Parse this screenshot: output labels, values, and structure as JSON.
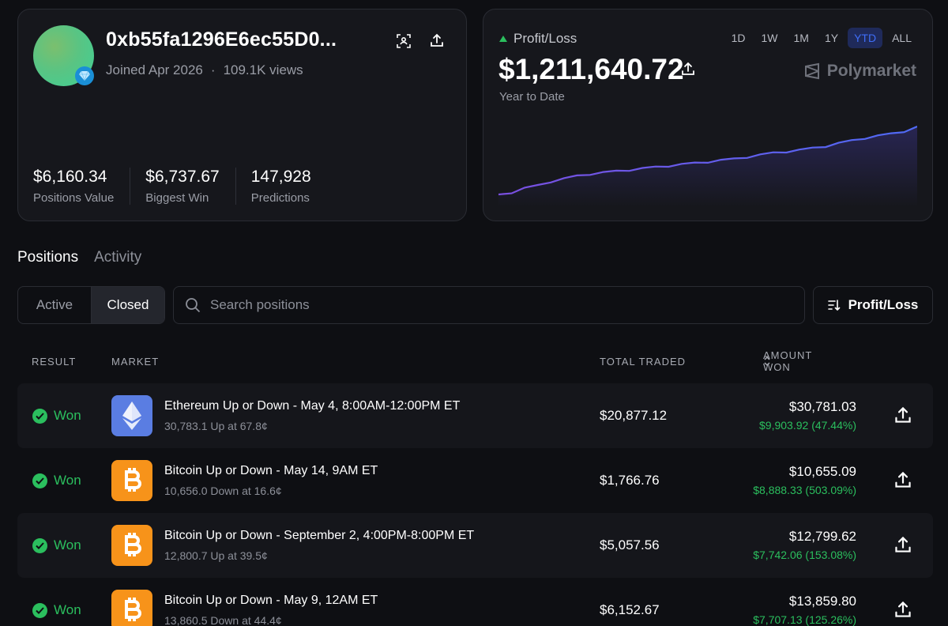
{
  "profile": {
    "username": "0xb55fa1296E6ec55D0...",
    "joined": "Joined Apr 2026",
    "separator": "·",
    "views": "109.1K views",
    "stats": [
      {
        "value": "$6,160.34",
        "label": "Positions Value"
      },
      {
        "value": "$6,737.67",
        "label": "Biggest Win"
      },
      {
        "value": "147,928",
        "label": "Predictions"
      }
    ]
  },
  "pnl": {
    "title": "Profit/Loss",
    "value": "$1,211,640.72",
    "period": "Year to Date",
    "brand": "Polymarket",
    "ranges": [
      "1D",
      "1W",
      "1M",
      "1Y",
      "YTD",
      "ALL"
    ],
    "active_range": "YTD",
    "line_color": "#6a55f0",
    "trend": [
      0.0,
      0.04,
      0.1,
      0.14,
      0.2,
      0.24,
      0.28,
      0.31,
      0.33,
      0.35,
      0.37,
      0.39,
      0.41,
      0.43,
      0.45,
      0.47,
      0.49,
      0.51,
      0.53,
      0.56,
      0.59,
      0.62,
      0.64,
      0.66,
      0.69,
      0.72,
      0.76,
      0.8,
      0.84,
      0.87,
      0.9,
      0.94,
      1.0
    ]
  },
  "tabs": [
    "Positions",
    "Activity"
  ],
  "active_tab": "Positions",
  "filters": {
    "active_label": "Active",
    "closed_label": "Closed",
    "search_placeholder": "Search positions",
    "sort_label": "Profit/Loss"
  },
  "table": {
    "headers": {
      "result": "RESULT",
      "market": "MARKET",
      "traded": "TOTAL TRADED",
      "amount": "AMOUNT WON"
    },
    "rows": [
      {
        "result": "Won",
        "coin": "eth",
        "title": "Ethereum Up or Down - May 4, 8:00AM-12:00PM ET",
        "sub": "30,783.1 Up at 67.8¢",
        "traded": "$20,877.12",
        "amount": "$30,781.03",
        "gain": "$9,903.92 (47.44%)"
      },
      {
        "result": "Won",
        "coin": "btc",
        "title": "Bitcoin Up or Down - May 14, 9AM ET",
        "sub": "10,656.0 Down at 16.6¢",
        "traded": "$1,766.76",
        "amount": "$10,655.09",
        "gain": "$8,888.33 (503.09%)"
      },
      {
        "result": "Won",
        "coin": "btc",
        "title": "Bitcoin Up or Down - September 2, 4:00PM-8:00PM ET",
        "sub": "12,800.7 Up at 39.5¢",
        "traded": "$5,057.56",
        "amount": "$12,799.62",
        "gain": "$7,742.06 (153.08%)"
      },
      {
        "result": "Won",
        "coin": "btc",
        "title": "Bitcoin Up or Down - May 9, 12AM ET",
        "sub": "13,860.5 Down at 44.4¢",
        "traded": "$6,152.67",
        "amount": "$13,859.80",
        "gain": "$7,707.13 (125.26%)"
      }
    ]
  },
  "colors": {
    "accent": "#3f6ef7",
    "positive": "#2bbf5e",
    "background": "#0e0f13",
    "card": "#16171c"
  }
}
